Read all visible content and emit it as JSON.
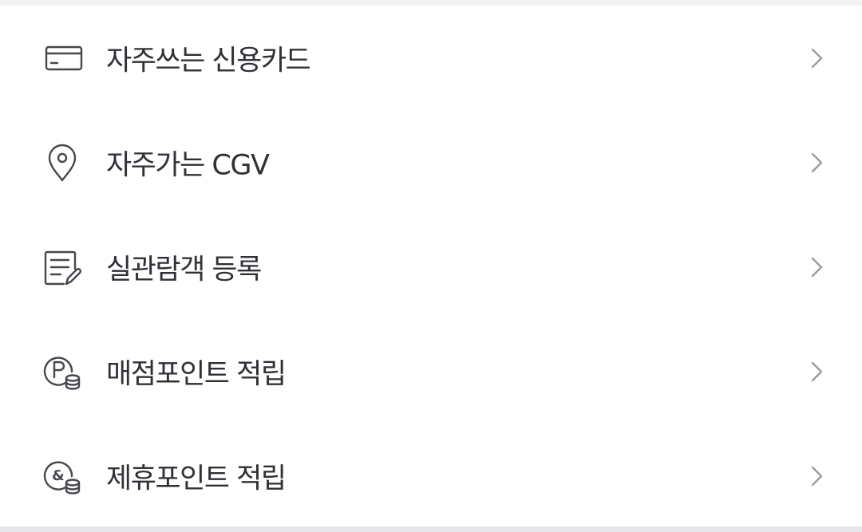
{
  "menu": {
    "items": [
      {
        "label": "자주쓰는 신용카드",
        "icon": "credit-card-icon"
      },
      {
        "label": "자주가는 CGV",
        "icon": "location-pin-icon"
      },
      {
        "label": "실관람객 등록",
        "icon": "document-edit-icon"
      },
      {
        "label": "매점포인트 적립",
        "icon": "p-coin-icon"
      },
      {
        "label": "제휴포인트 적립",
        "icon": "ampersand-coin-icon"
      }
    ]
  },
  "colors": {
    "icon": "#45474d",
    "text": "#2f3136",
    "chevron": "#9a9ca3",
    "background": "#ffffff",
    "divider": "#f2f2f4"
  }
}
